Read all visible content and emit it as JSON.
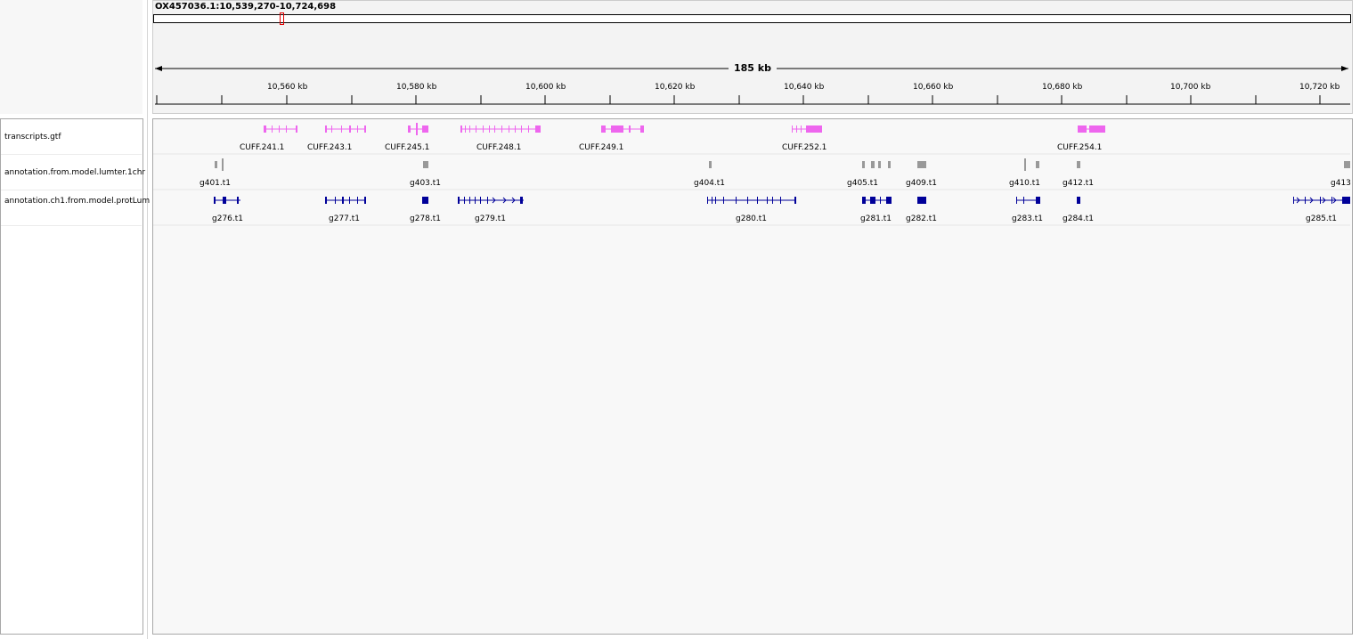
{
  "locus": "OX457036.1:10,539,270-10,724,698",
  "ruler": {
    "span_label": "185 kb",
    "ticks": [
      "10,560 kb",
      "10,580 kb",
      "10,600 kb",
      "10,620 kb",
      "10,640 kb",
      "10,660 kb",
      "10,680 kb",
      "10,700 kb",
      "10,720 kb"
    ]
  },
  "tracks": [
    {
      "name": "transcripts.gtf",
      "color": "#ee66ee",
      "features": [
        "CUFF.241.1",
        "CUFF.243.1",
        "CUFF.245.1",
        "CUFF.248.1",
        "CUFF.249.1",
        "CUFF.252.1",
        "CUFF.254.1"
      ]
    },
    {
      "name": "annotation.from.model.lumter.1chr",
      "color": "#999999",
      "features": [
        "g401.t1",
        "g403.t1",
        "g404.t1",
        "g405.t1",
        "g409.t1",
        "g410.t1",
        "g412.t1",
        "g413"
      ]
    },
    {
      "name": "annotation.ch1.from.model.protLum",
      "color": "#000099",
      "features": [
        "g276.t1",
        "g277.t1",
        "g278.t1",
        "g279.t1",
        "g280.t1",
        "g281.t1",
        "g282.t1",
        "g283.t1",
        "g284.t1",
        "g285.t1"
      ]
    }
  ],
  "colors": {
    "ideogram_marker": "#e00000",
    "ruler": "#000000"
  }
}
